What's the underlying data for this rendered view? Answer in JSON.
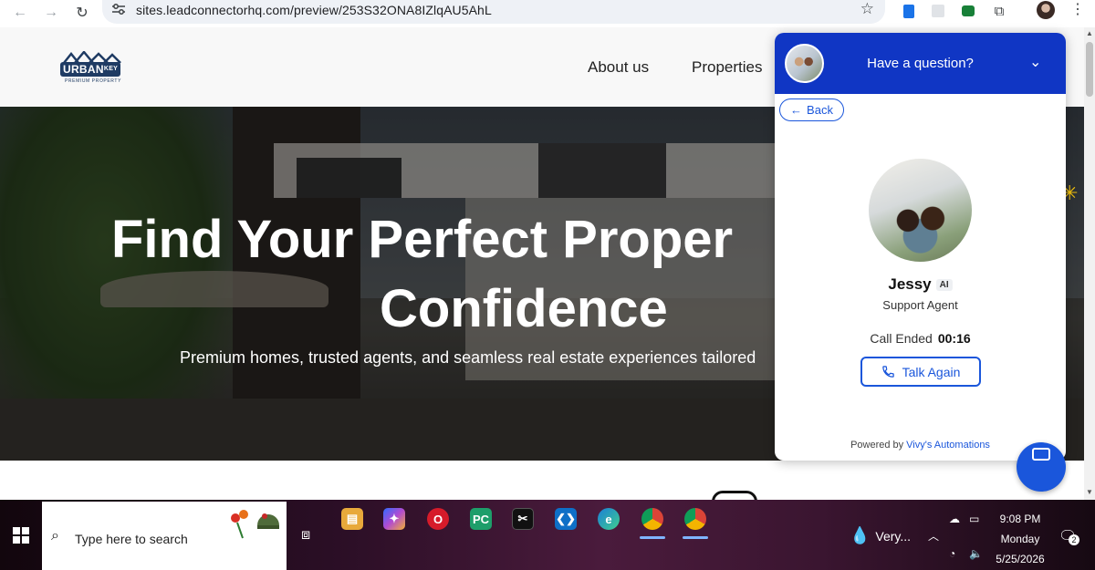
{
  "browser": {
    "url": "sites.leadconnectorhq.com/preview/253S32ONA8IZlqAU5AhL"
  },
  "site": {
    "logo": {
      "word": "URBAN",
      "word_suffix": "KEY",
      "tagline": "PREMIUM PROPERTY"
    },
    "nav": [
      "About us",
      "Properties"
    ],
    "hero": {
      "title_line1": "Find Your Perfect Proper",
      "title_line2": "Confidence",
      "subtitle": "Premium homes, trusted agents, and seamless real estate experiences tailored"
    }
  },
  "widget": {
    "header_title": "Have a question?",
    "back_label": "Back",
    "agent_name": "Jessy",
    "agent_badge": "AI",
    "agent_role": "Support Agent",
    "call_status": "Call Ended",
    "call_time": "00:16",
    "talk_again_label": "Talk Again",
    "powered_by": "Powered by",
    "powered_brand": "Vivy's Automations",
    "accent_color": "#1036c4"
  },
  "taskbar": {
    "search_placeholder": "Type here to search",
    "weather_text": "Very...",
    "time": "9:08 PM",
    "day": "Monday",
    "date": "5/25/2026",
    "notification_count": "2"
  }
}
